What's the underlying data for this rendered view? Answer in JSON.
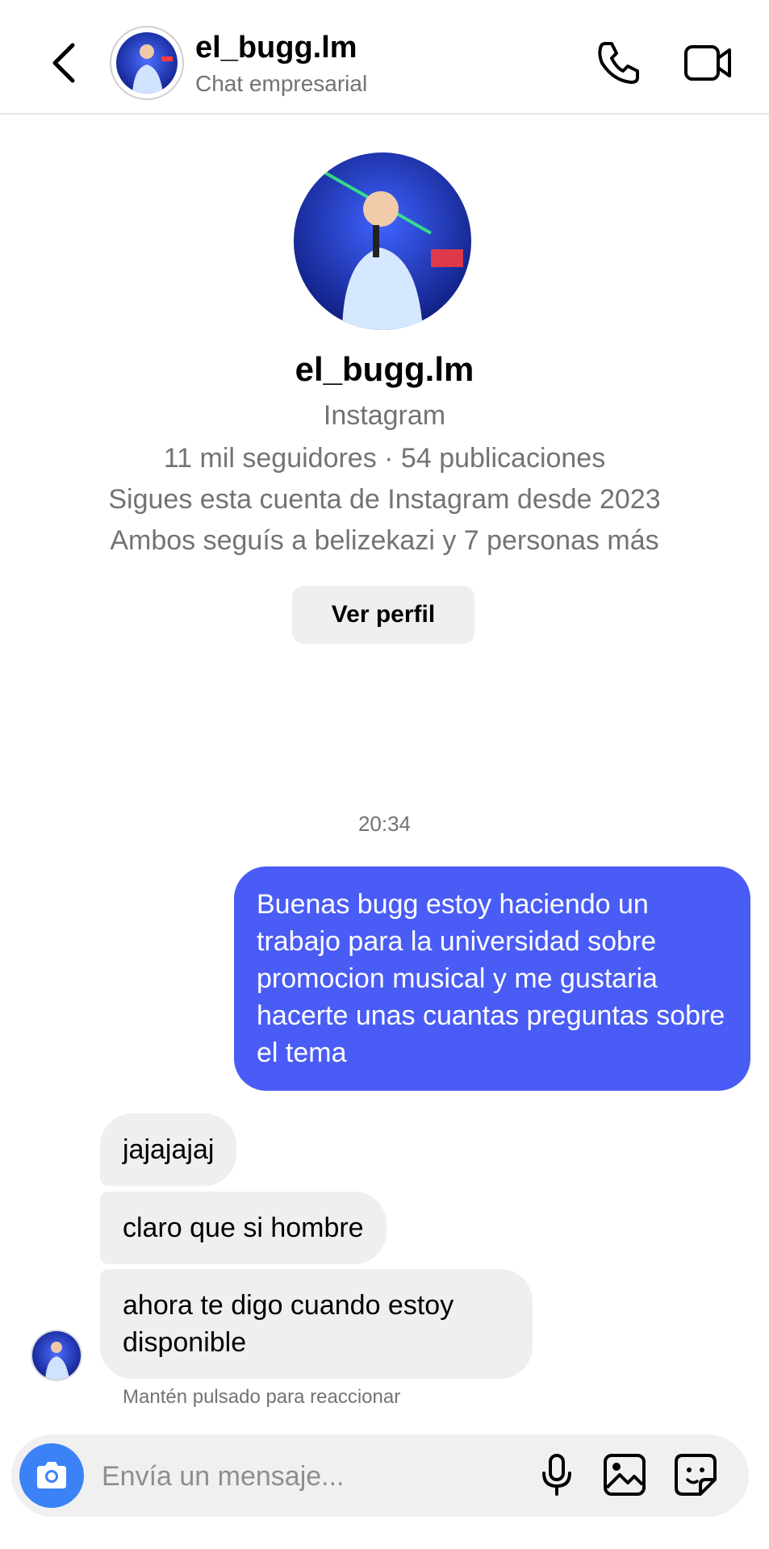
{
  "header": {
    "username": "el_bugg.lm",
    "subtitle": "Chat empresarial",
    "back_icon": "chevron-left-icon",
    "call_icon": "phone-icon",
    "video_icon": "video-camera-icon"
  },
  "profile": {
    "username": "el_bugg.lm",
    "platform": "Instagram",
    "stats": "11 mil seguidores · 54 publicaciones",
    "following_since": "Sigues esta cuenta de Instagram desde 2023",
    "mutuals": "Ambos seguís a belizekazi y 7 personas más",
    "view_profile_label": "Ver perfil"
  },
  "conversation": {
    "timestamp": "20:34",
    "messages": [
      {
        "direction": "outgoing",
        "text": "Buenas bugg estoy haciendo un trabajo para la universidad sobre promocion musical y me gustaria hacerte unas cuantas preguntas sobre el tema"
      },
      {
        "direction": "incoming",
        "text": "jajajajaj"
      },
      {
        "direction": "incoming",
        "text": "claro que si hombre"
      },
      {
        "direction": "incoming",
        "text": "ahora te digo cuando estoy disponible"
      }
    ],
    "react_hint": "Mantén pulsado para reaccionar"
  },
  "composer": {
    "placeholder": "Envía un mensaje...",
    "camera_icon": "camera-icon",
    "mic_icon": "microphone-icon",
    "gallery_icon": "image-gallery-icon",
    "sticker_icon": "sticker-icon"
  },
  "colors": {
    "outgoing_bubble": "#4a5cf6",
    "incoming_bubble": "#efefef",
    "camera_button": "#3b82f6",
    "secondary_text": "#737373"
  }
}
